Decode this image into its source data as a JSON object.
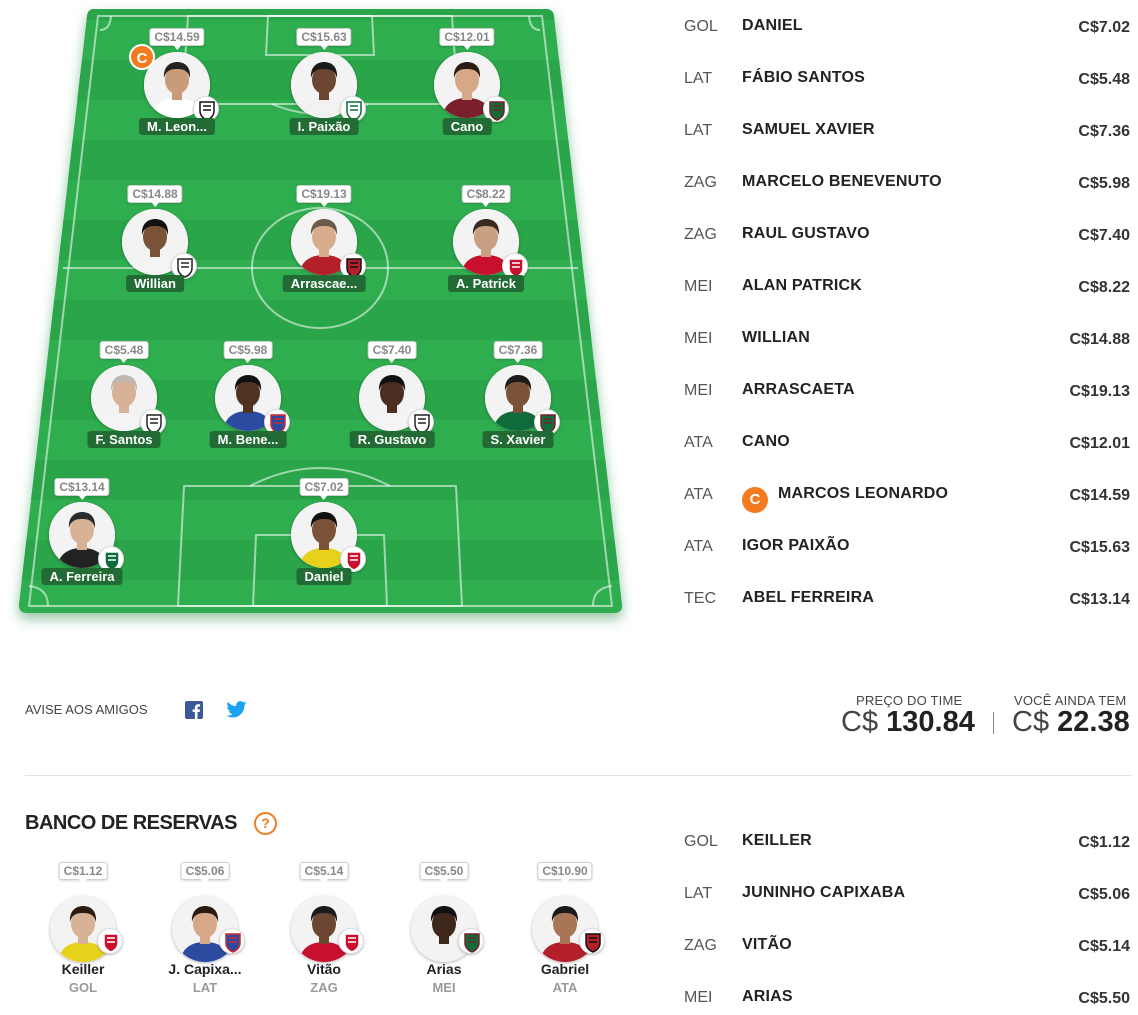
{
  "colors": {
    "field_green": "#2fae4f",
    "field_dark": "#24953f",
    "name_tag": "#236b35",
    "captain_orange": "#f47a20",
    "facebook_blue": "#3b5998",
    "twitter_blue": "#1da1f2"
  },
  "captain_badge": "C",
  "field_players": [
    {
      "name": "M. Leon...",
      "price": "C$14.59",
      "captain": true,
      "club_icon": "santos-crest-icon",
      "skin": "#c99b78",
      "hair": "#222",
      "shirt": "#ffffff"
    },
    {
      "name": "I. Paixão",
      "price": "C$15.63",
      "club_icon": "coritiba-crest-icon",
      "skin": "#6b4630",
      "hair": "#1b1b1b",
      "shirt": "#f2f2f2"
    },
    {
      "name": "Cano",
      "price": "C$12.01",
      "club_icon": "fluminense-crest-icon",
      "skin": "#d6a887",
      "hair": "#2a1c12",
      "shirt": "#7a1f2b"
    },
    {
      "name": "Willian",
      "price": "C$14.88",
      "club_icon": "corinthians-crest-icon",
      "skin": "#7a5238",
      "hair": "#111",
      "shirt": "#f4f4f4"
    },
    {
      "name": "Arrascae...",
      "price": "C$19.13",
      "club_icon": "flamengo-crest-icon",
      "skin": "#d7ad8e",
      "hair": "#6a5a4a",
      "shirt": "#b3202a"
    },
    {
      "name": "A. Patrick",
      "price": "C$8.22",
      "club_icon": "internacional-crest-icon",
      "skin": "#caa083",
      "hair": "#3a2a20",
      "shirt": "#c8102e"
    },
    {
      "name": "F. Santos",
      "price": "C$5.48",
      "club_icon": "corinthians-crest-icon",
      "skin": "#d9b196",
      "hair": "#bfb7ad",
      "shirt": "#f4f4f4"
    },
    {
      "name": "M. Bene...",
      "price": "C$5.98",
      "club_icon": "fortaleza-crest-icon",
      "skin": "#4e3222",
      "hair": "#111",
      "shirt": "#2b4aa0"
    },
    {
      "name": "R. Gustavo",
      "price": "C$7.40",
      "club_icon": "corinthians-crest-icon",
      "skin": "#4a2f20",
      "hair": "#111",
      "shirt": "#f4f4f4"
    },
    {
      "name": "S. Xavier",
      "price": "C$7.36",
      "club_icon": "fluminense-crest-icon",
      "skin": "#7a5238",
      "hair": "#1b1b1b",
      "shirt": "#0f6b3a"
    },
    {
      "name": "A. Ferreira",
      "price": "C$13.14",
      "club_icon": "palmeiras-crest-icon",
      "skin": "#d8b297",
      "hair": "#2b2b2b",
      "shirt": "#222"
    },
    {
      "name": "Daniel",
      "price": "C$7.02",
      "club_icon": "internacional-crest-icon",
      "skin": "#7a5238",
      "hair": "#111",
      "shirt": "#e6d21a"
    }
  ],
  "starters": [
    {
      "pos": "GOL",
      "name": "DANIEL",
      "price": "C$7.02"
    },
    {
      "pos": "LAT",
      "name": "FÁBIO SANTOS",
      "price": "C$5.48"
    },
    {
      "pos": "LAT",
      "name": "SAMUEL XAVIER",
      "price": "C$7.36"
    },
    {
      "pos": "ZAG",
      "name": "MARCELO BENEVENUTO",
      "price": "C$5.98"
    },
    {
      "pos": "ZAG",
      "name": "RAUL GUSTAVO",
      "price": "C$7.40"
    },
    {
      "pos": "MEI",
      "name": "ALAN PATRICK",
      "price": "C$8.22"
    },
    {
      "pos": "MEI",
      "name": "WILLIAN",
      "price": "C$14.88"
    },
    {
      "pos": "MEI",
      "name": "ARRASCAETA",
      "price": "C$19.13"
    },
    {
      "pos": "ATA",
      "name": "CANO",
      "price": "C$12.01"
    },
    {
      "pos": "ATA",
      "name": "MARCOS LEONARDO",
      "price": "C$14.59",
      "captain": true
    },
    {
      "pos": "ATA",
      "name": "IGOR PAIXÃO",
      "price": "C$15.63"
    },
    {
      "pos": "TEC",
      "name": "ABEL FERREIRA",
      "price": "C$13.14"
    }
  ],
  "share": {
    "label": "AVISE AOS AMIGOS",
    "facebook_icon": "facebook-icon",
    "twitter_icon": "twitter-icon"
  },
  "totals": {
    "team_price_label": "PREÇO DO TIME",
    "team_price_currency": "C$",
    "team_price_value": "130.84",
    "remaining_label": "VOCÊ AINDA TEM",
    "remaining_currency": "C$",
    "remaining_value": "22.38"
  },
  "bench": {
    "title": "BANCO DE RESERVAS",
    "help_icon": "?",
    "players": [
      {
        "name": "Keiller",
        "pos": "GOL",
        "price": "C$1.12",
        "club_icon": "internacional-crest-icon",
        "skin": "#d8b297",
        "hair": "#2a1c12",
        "shirt": "#e6d21a"
      },
      {
        "name": "J. Capixa...",
        "pos": "LAT",
        "price": "C$5.06",
        "club_icon": "fortaleza-crest-icon",
        "skin": "#d6a887",
        "hair": "#2a1c12",
        "shirt": "#2b4aa0"
      },
      {
        "name": "Vitão",
        "pos": "ZAG",
        "price": "C$5.14",
        "club_icon": "internacional-crest-icon",
        "skin": "#6b4630",
        "hair": "#1b1b1b",
        "shirt": "#c8102e"
      },
      {
        "name": "Arias",
        "pos": "MEI",
        "price": "C$5.50",
        "club_icon": "fluminense-crest-icon",
        "skin": "#3e281b",
        "hair": "#111",
        "shirt": "#f2f2f2"
      },
      {
        "name": "Gabriel",
        "pos": "ATA",
        "price": "C$10.90",
        "club_icon": "flamengo-crest-icon",
        "skin": "#a87656",
        "hair": "#1b1b1b",
        "shirt": "#b3202a"
      }
    ]
  },
  "bench_list": [
    {
      "pos": "GOL",
      "name": "KEILLER",
      "price": "C$1.12"
    },
    {
      "pos": "LAT",
      "name": "JUNINHO CAPIXABA",
      "price": "C$5.06"
    },
    {
      "pos": "ZAG",
      "name": "VITÃO",
      "price": "C$5.14"
    },
    {
      "pos": "MEI",
      "name": "ARIAS",
      "price": "C$5.50"
    }
  ]
}
